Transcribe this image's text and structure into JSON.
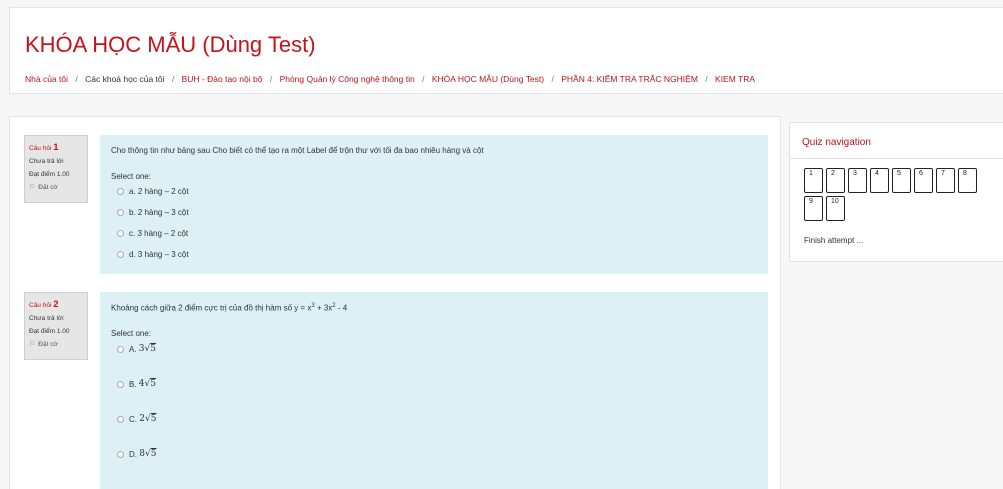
{
  "course": {
    "title": "KHÓA HỌC MẪU (Dùng Test)"
  },
  "breadcrumb": [
    {
      "label": "Nhà của tôi",
      "link": true
    },
    {
      "label": "Các khoá học của tôi",
      "link": false
    },
    {
      "label": "BUH - Đào tạo nội bộ",
      "link": true
    },
    {
      "label": "Phòng Quản lý Công nghệ thông tin",
      "link": true
    },
    {
      "label": "KHÓA HỌC MẪU (Dùng Test)",
      "link": true
    },
    {
      "label": "PHẦN 4: KIỂM TRA TRẮC NGHIỆM",
      "link": true
    },
    {
      "label": "KIEM TRA",
      "link": true
    }
  ],
  "breadcrumb_separator": "/",
  "questions": [
    {
      "label": "Câu hỏi",
      "number": "1",
      "status": "Chưa trả lời",
      "grade": "Đạt điểm 1.00",
      "flag": "Đặt cờ",
      "text": "Cho thông tin như bảng sau Cho biết có thể tạo ra một Label để trộn thư với tối đa bao nhiêu hàng và cột",
      "select_one": "Select one:",
      "options": [
        "a. 2 hàng – 2 cột",
        "b. 2 hàng – 3 cột",
        "c. 3 hàng – 2 cột",
        "d. 3 hàng – 3 cột"
      ]
    },
    {
      "label": "Câu hỏi",
      "number": "2",
      "status": "Chưa trả lời",
      "grade": "Đạt điểm 1.00",
      "flag": "Đặt cờ",
      "text_prefix": "Khoảng cách giữa 2 điểm cực trị của đồ thị hàm số y = x",
      "text_sup1": "3",
      "text_mid": " + 3x",
      "text_sup2": "2",
      "text_suffix": " - 4",
      "select_one": "Select one:",
      "options": [
        {
          "letter": "A.",
          "coef": "3",
          "radicand": "5"
        },
        {
          "letter": "B.",
          "coef": "4",
          "radicand": "5"
        },
        {
          "letter": "C.",
          "coef": "2",
          "radicand": "5"
        },
        {
          "letter": "D.",
          "coef": "8",
          "radicand": "5"
        }
      ]
    }
  ],
  "quiz_nav": {
    "title": "Quiz navigation",
    "buttons": [
      "1",
      "2",
      "3",
      "4",
      "5",
      "6",
      "7",
      "8",
      "9",
      "10"
    ],
    "finish": "Finish attempt ..."
  },
  "colors": {
    "accent": "#c4131a",
    "question_bg": "#dcf0f6",
    "info_bg": "#e6e6e6"
  }
}
